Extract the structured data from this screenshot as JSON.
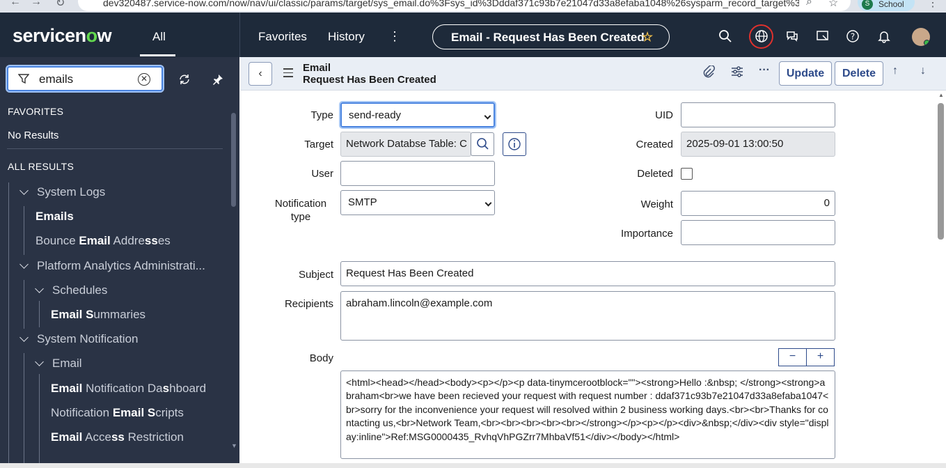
{
  "browser": {
    "url": "dev320487.service-now.com/now/nav/ui/classic/params/target/sys_email.do%3Fsys_id%3Dddaf371c93b7e21047d33a8efaba1048%26sysparm_record_target%3...",
    "profile_label": "School",
    "profile_initial": "S"
  },
  "topnav": {
    "logo_text_pre": "servicen",
    "logo_o": "o",
    "logo_text_post": "w",
    "all_tab": "All",
    "favorites": "Favorites",
    "history": "History",
    "record_title": "Email - Request Has Been Created",
    "accent": "#62d84e"
  },
  "sidebar": {
    "filter_value": "emails",
    "favorites_heading": "FAVORITES",
    "no_results": "No Results",
    "all_results_heading": "ALL RESULTS",
    "items": [
      {
        "pre": "",
        "bold": "",
        "post": "System Logs"
      },
      {
        "pre": "",
        "bold": "Emails",
        "post": ""
      },
      {
        "pre": "Bounce ",
        "bold": "Email",
        "post": " Addre",
        "bold2": "ss",
        "post2": "es"
      },
      {
        "pre": "",
        "bold": "",
        "post": "Platform Analytics Administrati..."
      },
      {
        "pre": "",
        "bold": "",
        "post": "Schedules"
      },
      {
        "pre": "",
        "bold": "Email S",
        "post": "ummaries"
      },
      {
        "pre": "",
        "bold": "",
        "post": "System Notification"
      },
      {
        "pre": "",
        "bold": "",
        "post": "Email"
      },
      {
        "pre": "",
        "bold": "Email",
        "post": " Notification Da",
        "bold2": "s",
        "post2": "hboard"
      },
      {
        "pre": "Notification ",
        "bold": "Email S",
        "post": "cripts"
      },
      {
        "pre": "",
        "bold": "Email",
        "post": " Acce",
        "bold2": "ss",
        "post2": " Restriction"
      }
    ]
  },
  "header": {
    "table": "Email",
    "record": "Request Has Been Created",
    "update": "Update",
    "delete": "Delete"
  },
  "form": {
    "type_label": "Type",
    "type_value": "send-ready",
    "target_label": "Target",
    "target_value": "Network Databse Table: C",
    "user_label": "User",
    "user_value": "",
    "notification_type_label_1": "Notification",
    "notification_type_label_2": "type",
    "notification_type_value": "SMTP",
    "uid_label": "UID",
    "uid_value": "",
    "created_label": "Created",
    "created_value": "2025-09-01 13:00:50",
    "deleted_label": "Deleted",
    "weight_label": "Weight",
    "weight_value": "0",
    "importance_label": "Importance",
    "importance_value": "",
    "subject_label": "Subject",
    "subject_value": "Request Has Been Created",
    "recipients_label": "Recipients",
    "recipients_value": "abraham.lincoln@example.com",
    "body_label": "Body",
    "body_value": "<html><head></head><body><p></p><p data-tinymcerootblock=\"\"><strong>Hello :&nbsp; </strong><strong>abraham<br>we have been recieved your request with request number : ddaf371c93b7e21047d33a8efaba1047<br>sorry for the inconvenience your request will resolved within 2 business working days.<br><br>Thanks for contacting us,<br>Network Team,<br><br><br><br><br></strong></p><p></p><div>&nbsp;</div><div style=\"display:inline\">Ref:MSG0000435_RvhqVhPGZrr7MhbaVf51</div></body></html>"
  }
}
